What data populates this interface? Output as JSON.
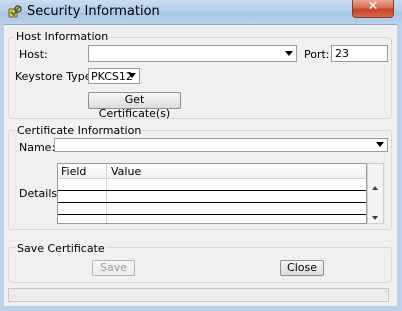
{
  "window": {
    "title": "Security Information",
    "close_glyph": "✕",
    "icon": "key-lock-icon",
    "accent_close": "#d05a40"
  },
  "host_group": {
    "legend": "Host Information",
    "host_label": "Host:",
    "host_value": "",
    "port_label": "Port:",
    "port_value": "23",
    "keystore_label": "Keystore Type:",
    "keystore_value": "PKCS12",
    "get_cert_button": "Get Certificate(s)"
  },
  "cert_group": {
    "legend": "Certificate Information",
    "name_label": "Name:",
    "name_value": "",
    "details_label": "Details:",
    "table": {
      "columns": [
        "Field",
        "Value"
      ],
      "rows": [
        [
          "",
          ""
        ],
        [
          "",
          ""
        ],
        [
          "",
          ""
        ],
        [
          "",
          ""
        ]
      ]
    }
  },
  "save_group": {
    "legend": "Save Certificate",
    "save_button": "Save",
    "close_button": "Close"
  },
  "status": {
    "text": ""
  }
}
